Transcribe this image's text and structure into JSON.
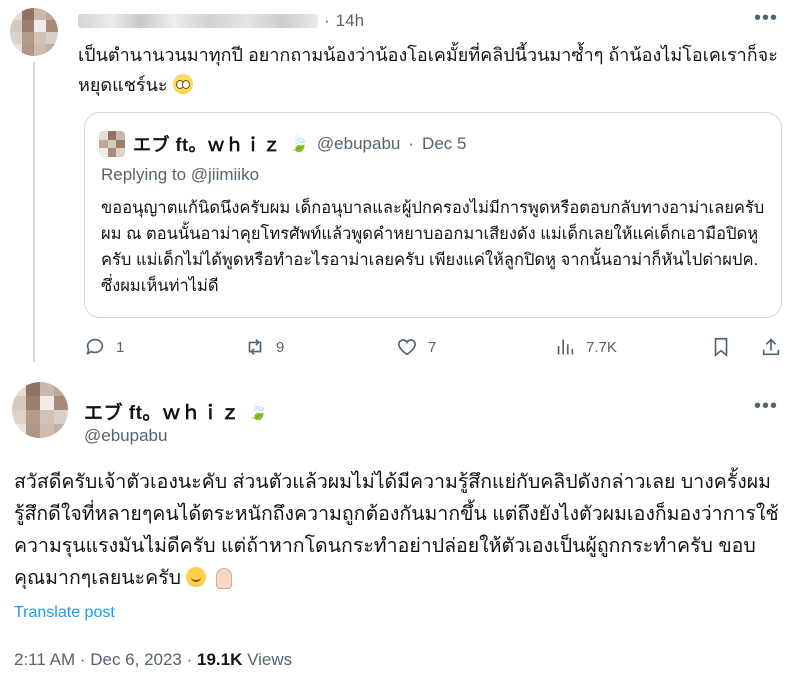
{
  "post1": {
    "time": "14h",
    "text": "เป็นตำนานวนมาทุกปี อยากถามน้องว่าน้องโอเคมั้ยที่คลิปนี้วนมาซ้ำๆ ถ้าน้องไม่โอเคเราก็จะหยุดแชร์นะ",
    "emoji": "pleading-face"
  },
  "quote": {
    "name": "エブ ft。ｗｈｉｚ",
    "handle": "@ebupabu",
    "date": "Dec 5",
    "replying_to": "Replying to @jiimiiko",
    "text": "ขออนุญาตแก้นิดนึงครับผม เด็กอนุบาลและผู้ปกครองไม่มีการพูดหรือตอบกลับทางอาม่าเลยครับผม ณ ตอนนั้นอาม่าคุยโทรศัพท์แล้วพูดคำหยาบออกมาเสียงดัง แม่เด็กเลยให้แค่เด็กเอามือปิดหูครับ แม่เด็กไม่ได้พูดหรือทำอะไรอาม่าเลยครับ เพียงแค่ให้ลูกปิดหู จากนั้นอาม่าก็หันไปด่าผปค. ซึ่งผมเห็นท่าไม่ดี"
  },
  "actions": {
    "replies": "1",
    "reposts": "9",
    "likes": "7",
    "views": "7.7K"
  },
  "post2": {
    "name": "エブ ft。ｗｈｉｚ",
    "handle": "@ebupabu",
    "text": "สวัสดีครับเจ้าตัวเองนะคับ ส่วนตัวแล้วผมไม่ได้มีความรู้สึกแย่กับคลิปดังกล่าวเลย บางครั้งผมรู้สึกดีใจที่หลายๆคนได้ตระหนักถึงความถูกต้องกันมากขึ้น แต่ถึงยังไงตัวผมเองก็มองว่าการใช้ความรุนแรงมันไม่ดีครับ แต่ถ้าหากโดนกระทำอย่าปล่อยให้ตัวเองเป็นผู้ถูกกระทำครับ ขอบคุณมากๆเลยนะครับ",
    "translate": "Translate post",
    "time": "2:11 AM · Dec 6, 2023 · ",
    "views_count": "19.1K",
    "views_label": " Views"
  },
  "colors": {
    "link": "#1d9bf0",
    "muted": "#536471",
    "border": "#cfd9de",
    "leaf": "#5aa469"
  }
}
